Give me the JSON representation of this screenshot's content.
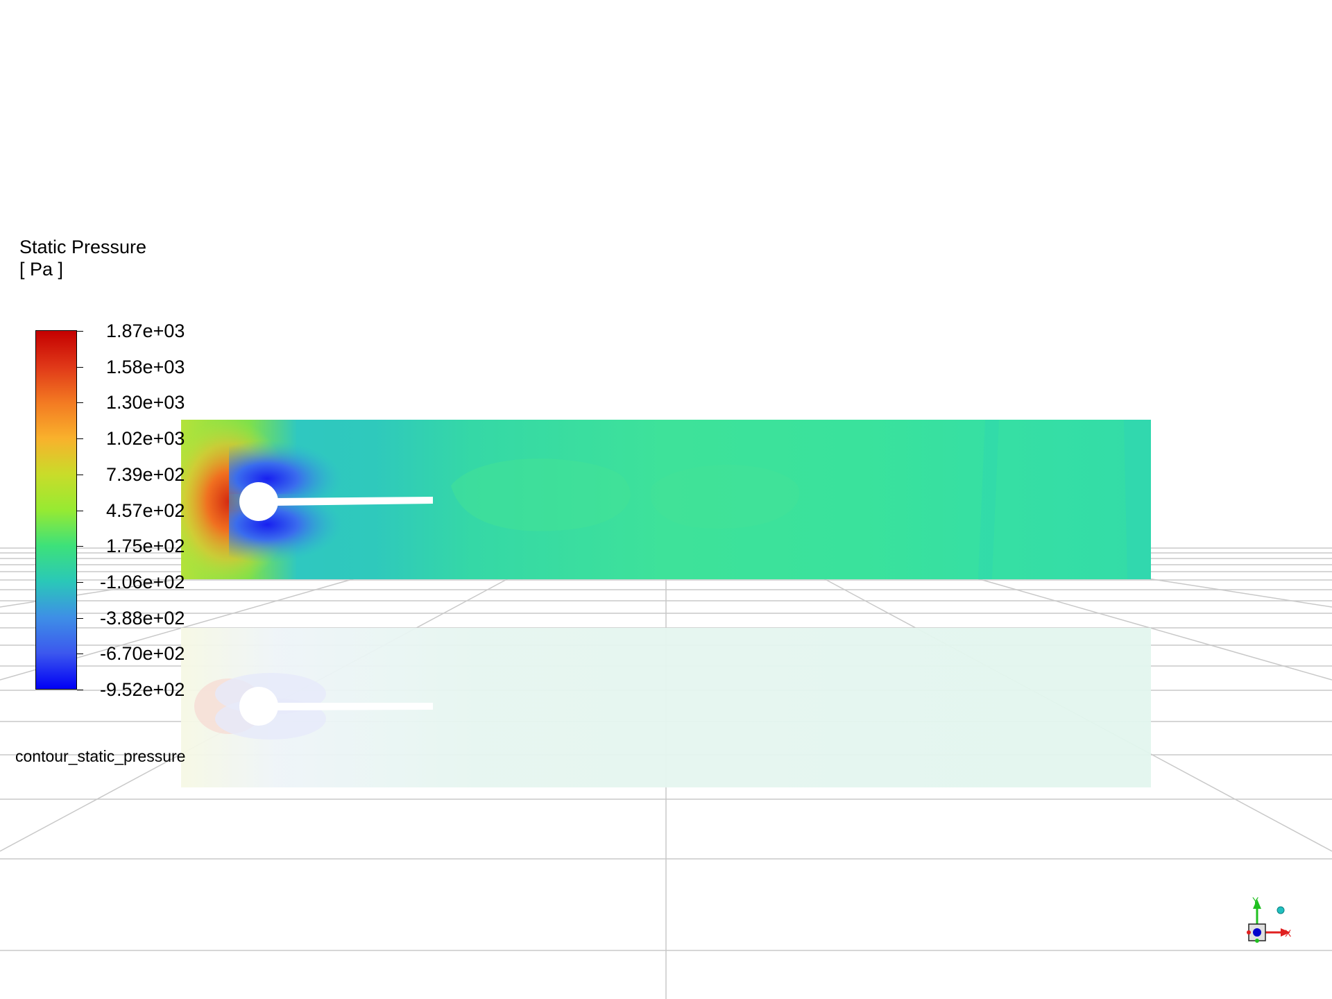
{
  "legend": {
    "title": "Static Pressure",
    "unit": "[ Pa ]",
    "ticks": [
      "1.87e+03",
      "1.58e+03",
      "1.30e+03",
      "1.02e+03",
      "7.39e+02",
      "4.57e+02",
      "1.75e+02",
      "-1.06e+02",
      "-3.88e+02",
      "-6.70e+02",
      "-9.52e+02"
    ],
    "gradient": [
      "#c40000",
      "#e03818",
      "#f37a22",
      "#f9b12c",
      "#c9dc2a",
      "#97ea32",
      "#3de17a",
      "#2ac8b8",
      "#3e8fe6",
      "#3c58ee",
      "#0000f5"
    ]
  },
  "contour_name": "contour_static_pressure",
  "triad": {
    "x_label": "X",
    "y_label": "Y",
    "x_color": "#e02020",
    "y_color": "#20c020",
    "z_color": "#0000cc"
  },
  "colors": {
    "background": "#ffffff",
    "grid": "#c8c8c8",
    "domain_base": "#38dea4",
    "obstacle": "#ffffff"
  }
}
